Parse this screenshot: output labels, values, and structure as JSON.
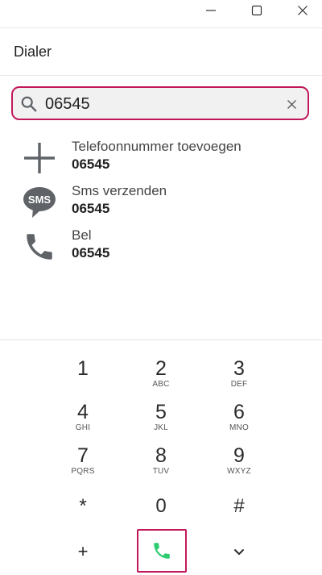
{
  "window": {
    "controls": [
      "minimize-icon",
      "maximize-icon",
      "close-icon"
    ]
  },
  "header": {
    "title": "Dialer"
  },
  "search": {
    "value": "06545",
    "icon": "search-icon",
    "clear_icon": "close-icon"
  },
  "actions": [
    {
      "icon": "plus-icon",
      "label": "Telefoonnummer toevoegen",
      "number": "06545"
    },
    {
      "icon": "sms-icon",
      "label": "Sms verzenden",
      "number": "06545"
    },
    {
      "icon": "phone-icon",
      "label": "Bel",
      "number": "06545"
    }
  ],
  "keypad": {
    "keys": [
      {
        "digit": "1",
        "letters": ""
      },
      {
        "digit": "2",
        "letters": "ABC"
      },
      {
        "digit": "3",
        "letters": "DEF"
      },
      {
        "digit": "4",
        "letters": "GHI"
      },
      {
        "digit": "5",
        "letters": "JKL"
      },
      {
        "digit": "6",
        "letters": "MNO"
      },
      {
        "digit": "7",
        "letters": "PQRS"
      },
      {
        "digit": "8",
        "letters": "TUV"
      },
      {
        "digit": "9",
        "letters": "WXYZ"
      },
      {
        "digit": "*",
        "letters": ""
      },
      {
        "digit": "0",
        "letters": ""
      },
      {
        "digit": "#",
        "letters": ""
      }
    ],
    "plus": "+",
    "call_icon": "phone-icon",
    "collapse_icon": "chevron-down-icon"
  },
  "colors": {
    "accent": "#c2185b",
    "call_green": "#2ecc71",
    "icon_gray": "#5f6368"
  }
}
